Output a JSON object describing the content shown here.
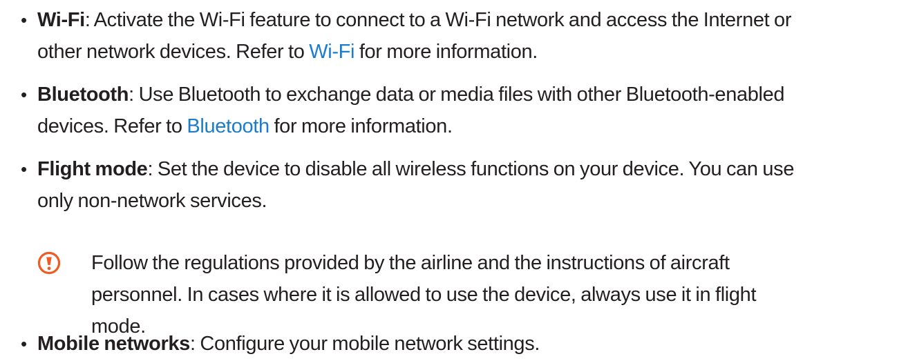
{
  "items": [
    {
      "term": "Wi-Fi",
      "line1": ": Activate the Wi-Fi feature to connect to a Wi-Fi network and access the Internet or",
      "line2_pre": "other network devices. Refer to ",
      "line2_link": "Wi-Fi",
      "line2_post": " for more information."
    },
    {
      "term": "Bluetooth",
      "line1": ": Use Bluetooth to exchange data or media files with other Bluetooth-enabled",
      "line2_pre": "devices. Refer to ",
      "line2_link": "Bluetooth",
      "line2_post": " for more information."
    },
    {
      "term": "Flight mode",
      "line1": ": Set the device to disable all wireless functions on your device. You can use",
      "line2": "only non-network services."
    },
    {
      "term": "Mobile networks",
      "line1": ": Configure your mobile network settings."
    }
  ],
  "caution_note": {
    "icon": "caution-icon",
    "line1": "Follow the regulations provided by the airline and the instructions of aircraft",
    "line2": "personnel. In cases where it is allowed to use the device, always use it in flight",
    "line3": "mode."
  },
  "colors": {
    "text": "#231f20",
    "link": "#1a7ccf",
    "caution": "#f15a22"
  }
}
